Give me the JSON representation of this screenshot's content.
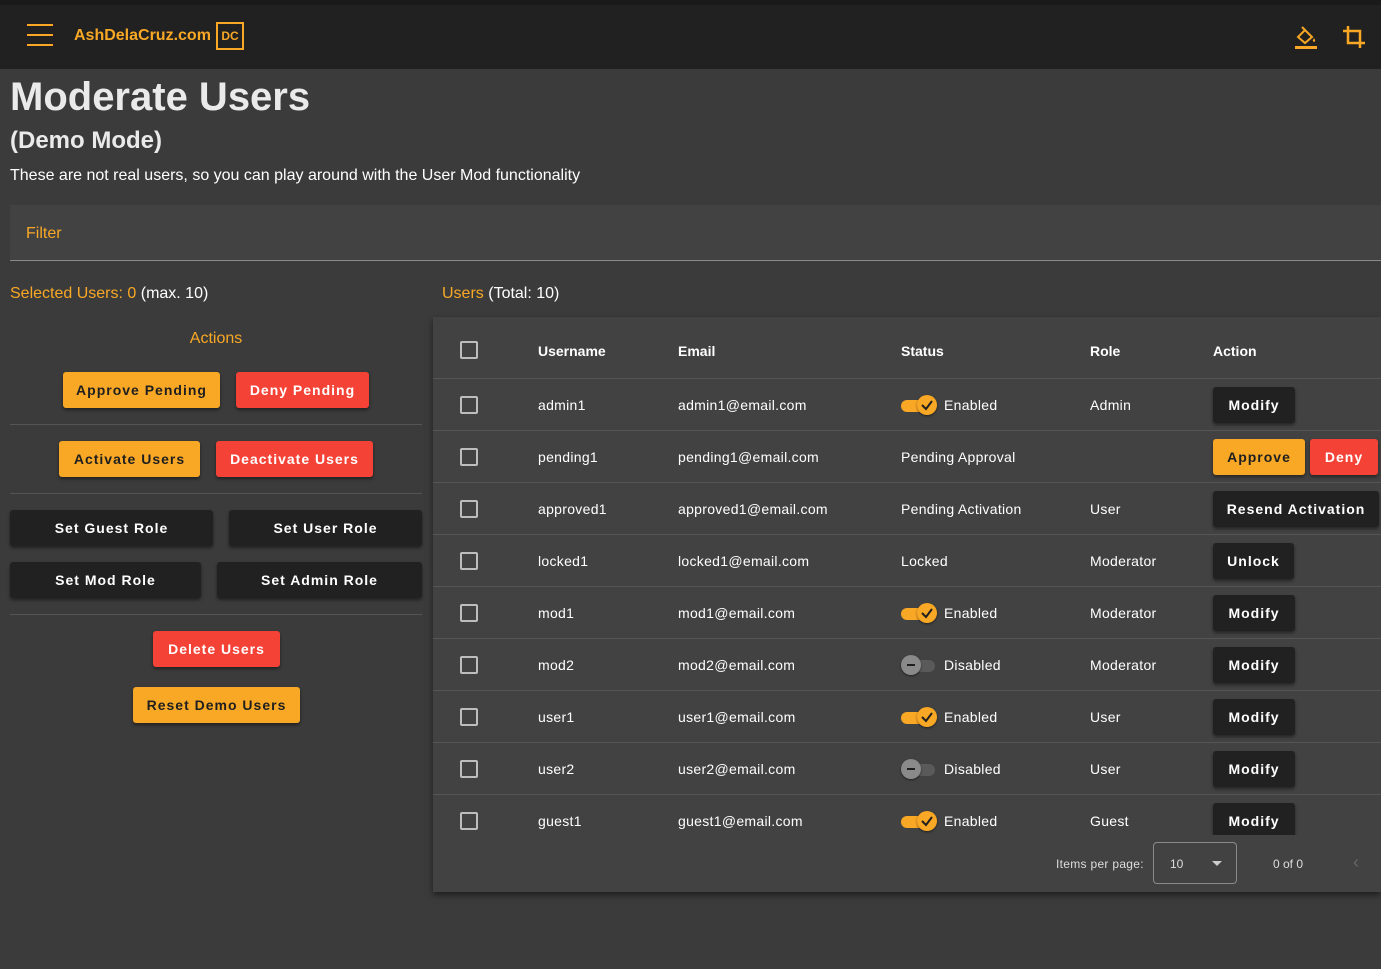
{
  "header": {
    "brand": "AshDelaCruz.com",
    "logo_text": "DC",
    "icons": [
      "menu-icon",
      "paint-bucket-icon",
      "crop-icon"
    ]
  },
  "page": {
    "title": "Moderate Users",
    "subtitle": "(Demo Mode)",
    "description": "These are not real users, so you can play around with the User Mod functionality"
  },
  "filter": {
    "label": "Filter"
  },
  "selection": {
    "label": "Selected Users: 0",
    "max": "(max. 10)"
  },
  "actions": {
    "title": "Actions",
    "approve_pending": "Approve Pending",
    "deny_pending": "Deny Pending",
    "activate_users": "Activate Users",
    "deactivate_users": "Deactivate Users",
    "set_guest_role": "Set Guest Role",
    "set_user_role": "Set User Role",
    "set_mod_role": "Set Mod Role",
    "set_admin_role": "Set Admin Role",
    "delete_users": "Delete Users",
    "reset_demo_users": "Reset Demo Users"
  },
  "users_table": {
    "title": "Users",
    "total": "(Total: 10)",
    "columns": [
      "Username",
      "Email",
      "Status",
      "Role",
      "Action"
    ],
    "rows": [
      {
        "username": "admin1",
        "email": "admin1@email.com",
        "status": "Enabled",
        "toggle": "on",
        "role": "Admin",
        "actions": [
          "Modify"
        ]
      },
      {
        "username": "pending1",
        "email": "pending1@email.com",
        "status": "Pending Approval",
        "toggle": "none",
        "role": "",
        "actions": [
          "Approve",
          "Deny"
        ]
      },
      {
        "username": "approved1",
        "email": "approved1@email.com",
        "status": "Pending Activation",
        "toggle": "none",
        "role": "User",
        "actions": [
          "Resend Activation"
        ]
      },
      {
        "username": "locked1",
        "email": "locked1@email.com",
        "status": "Locked",
        "toggle": "none",
        "role": "Moderator",
        "actions": [
          "Unlock"
        ]
      },
      {
        "username": "mod1",
        "email": "mod1@email.com",
        "status": "Enabled",
        "toggle": "on",
        "role": "Moderator",
        "actions": [
          "Modify"
        ]
      },
      {
        "username": "mod2",
        "email": "mod2@email.com",
        "status": "Disabled",
        "toggle": "off",
        "role": "Moderator",
        "actions": [
          "Modify"
        ]
      },
      {
        "username": "user1",
        "email": "user1@email.com",
        "status": "Enabled",
        "toggle": "on",
        "role": "User",
        "actions": [
          "Modify"
        ]
      },
      {
        "username": "user2",
        "email": "user2@email.com",
        "status": "Disabled",
        "toggle": "off",
        "role": "User",
        "actions": [
          "Modify"
        ]
      },
      {
        "username": "guest1",
        "email": "guest1@email.com",
        "status": "Enabled",
        "toggle": "on",
        "role": "Guest",
        "actions": [
          "Modify"
        ]
      }
    ]
  },
  "paginator": {
    "items_per_page_label": "Items per page:",
    "items_per_page_value": "10",
    "range": "0 of 0"
  },
  "colors": {
    "accent": "#f9a825",
    "danger": "#f44336",
    "navbar": "#212121",
    "background": "#3b3b3b",
    "card": "#424242"
  }
}
